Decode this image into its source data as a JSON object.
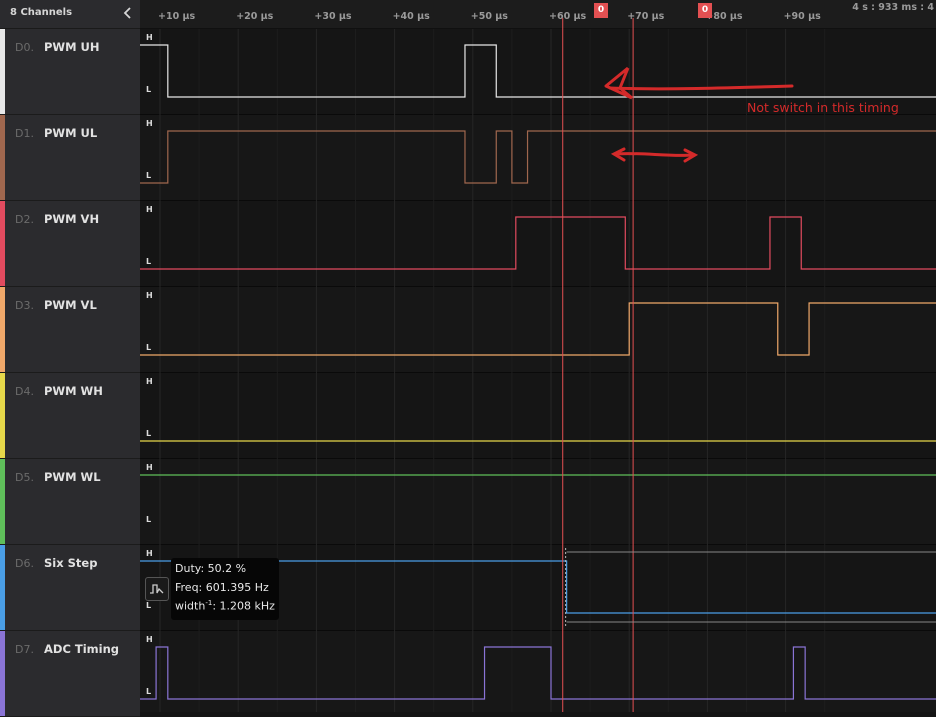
{
  "sidebar": {
    "title": "8 Channels",
    "channels": [
      {
        "index": "D0.",
        "name": "PWM UH",
        "color": "#e8e8e8"
      },
      {
        "index": "D1.",
        "name": "PWM UL",
        "color": "#a0674e"
      },
      {
        "index": "D2.",
        "name": "PWM VH",
        "color": "#e24b5f"
      },
      {
        "index": "D3.",
        "name": "PWM VL",
        "color": "#f0a86a"
      },
      {
        "index": "D4.",
        "name": "PWM WH",
        "color": "#e6d84a"
      },
      {
        "index": "D5.",
        "name": "PWM WL",
        "color": "#5fbf5a"
      },
      {
        "index": "D6.",
        "name": "Six Step",
        "color": "#4a9ee6"
      },
      {
        "index": "D7.",
        "name": "ADC Timing",
        "color": "#8a74d6"
      }
    ]
  },
  "ruler": {
    "ticks": [
      "+10 µs",
      "+20 µs",
      "+30 µs",
      "+40 µs",
      "+50 µs",
      "+60 µs",
      "+70 µs",
      "+80 µs",
      "+90 µs"
    ],
    "time_info": "4 s : 933 ms : 4",
    "cursor_a_label": "0",
    "cursor_b_label": "0"
  },
  "level_labels": {
    "high": "H",
    "low": "L"
  },
  "measurement": {
    "duty": "Duty: 50.2 %",
    "freq": "Freq: 601.395 Hz",
    "width_prefix": "width",
    "width_sup": "-1",
    "width_value": ": 1.208 kHz"
  },
  "annotation": {
    "text": "Not switch in this timing",
    "color": "#d42a2a"
  },
  "traces": [
    {
      "channel": "D0",
      "edges_us": [
        7,
        11,
        49,
        53
      ],
      "start_level": 0
    },
    {
      "channel": "D1",
      "edges_us": [
        6.5,
        11,
        49,
        53,
        55,
        57
      ],
      "start_level": 1
    },
    {
      "channel": "D2",
      "edges_us": [
        55.5,
        69.5,
        88,
        92
      ],
      "start_level": 0
    },
    {
      "channel": "D3",
      "edges_us": [
        70,
        89,
        93
      ],
      "start_level": 0
    },
    {
      "channel": "D4",
      "edges_us": [],
      "start_level": 0
    },
    {
      "channel": "D5",
      "edges_us": [],
      "start_level": 1
    },
    {
      "channel": "D6",
      "edges_us": [
        62
      ],
      "start_level": 1
    },
    {
      "channel": "D7",
      "edges_us": [
        9.5,
        11,
        51.5,
        60,
        91,
        92.5
      ],
      "start_level": 0
    }
  ],
  "cursors_us": [
    61.5,
    70.5
  ]
}
